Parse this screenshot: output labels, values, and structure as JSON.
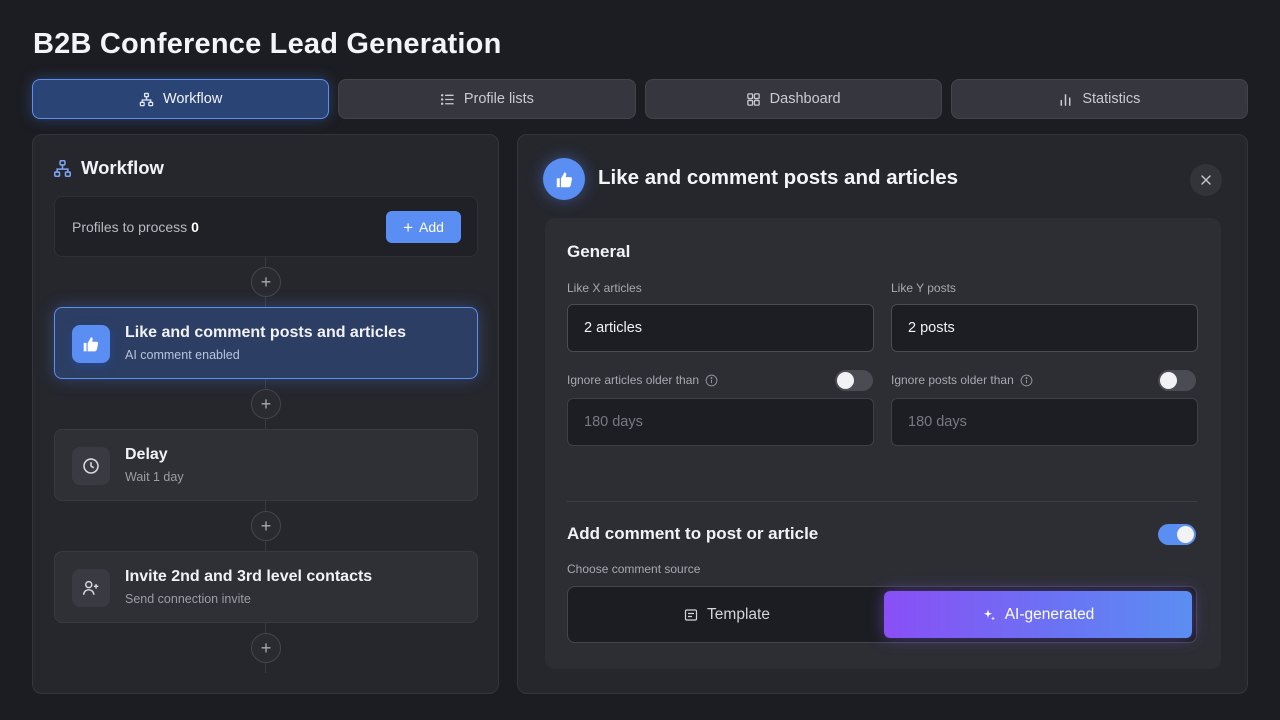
{
  "page": {
    "title": "B2B Conference Lead Generation"
  },
  "tabs": [
    {
      "label": "Workflow",
      "icon": "workflow-icon",
      "active": true
    },
    {
      "label": "Profile lists",
      "icon": "list-icon",
      "active": false
    },
    {
      "label": "Dashboard",
      "icon": "grid-icon",
      "active": false
    },
    {
      "label": "Statistics",
      "icon": "bar-chart-icon",
      "active": false
    }
  ],
  "workflow": {
    "title": "Workflow",
    "profiles_label": "Profiles to process",
    "profiles_count": "0",
    "add_label": "Add",
    "steps": [
      {
        "title": "Like and comment posts and articles",
        "subtitle": "AI comment enabled",
        "icon": "thumbs-up-icon",
        "active": true
      },
      {
        "title": "Delay",
        "subtitle": "Wait 1 day",
        "icon": "clock-icon",
        "active": false
      },
      {
        "title": "Invite 2nd and 3rd level contacts",
        "subtitle": "Send connection invite",
        "icon": "user-plus-icon",
        "active": false
      }
    ]
  },
  "detail": {
    "title": "Like and comment posts and articles",
    "general_title": "General",
    "like_articles_label": "Like X articles",
    "like_articles_value": "2 articles",
    "like_posts_label": "Like Y posts",
    "like_posts_value": "2 posts",
    "ignore_articles_label": "Ignore articles older than",
    "ignore_articles_placeholder": "180 days",
    "ignore_articles_enabled": false,
    "ignore_posts_label": "Ignore posts older than",
    "ignore_posts_placeholder": "180 days",
    "ignore_posts_enabled": false,
    "comment_title": "Add comment to post or article",
    "comment_enabled": true,
    "source_label": "Choose comment source",
    "source_options": [
      "Template",
      "AI-generated"
    ],
    "source_selected": "AI-generated"
  },
  "colors": {
    "accent": "#5b8ef2",
    "background": "#1c1d22",
    "panel": "#26272d",
    "gradient_start": "#8a4ff5",
    "gradient_end": "#5b8ef2"
  }
}
